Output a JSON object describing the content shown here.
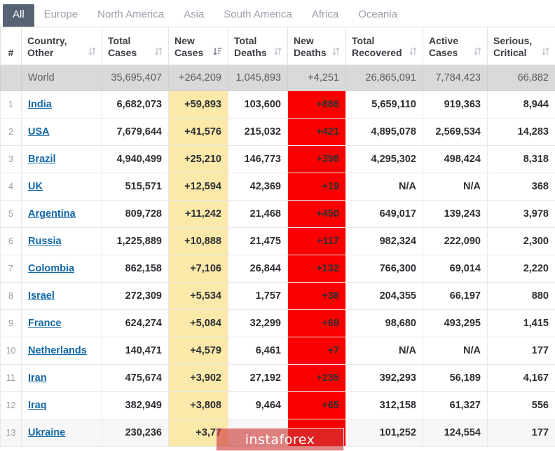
{
  "tabs": [
    {
      "label": "All",
      "active": true
    },
    {
      "label": "Europe",
      "active": false
    },
    {
      "label": "North America",
      "active": false
    },
    {
      "label": "Asia",
      "active": false
    },
    {
      "label": "South America",
      "active": false
    },
    {
      "label": "Africa",
      "active": false
    },
    {
      "label": "Oceania",
      "active": false
    }
  ],
  "columns": [
    {
      "key": "index",
      "label": "#",
      "sort_icon": ""
    },
    {
      "key": "country",
      "label": "Country,\nOther",
      "line1": "Country,",
      "line2": "Other",
      "sort_icon": "sort-both-icon"
    },
    {
      "key": "total_cases",
      "line1": "Total",
      "line2": "Cases",
      "sort_icon": "sort-both-icon"
    },
    {
      "key": "new_cases",
      "line1": "New",
      "line2": "Cases",
      "sort_icon": "sort-amount-desc-icon"
    },
    {
      "key": "total_deaths",
      "line1": "Total",
      "line2": "Deaths",
      "sort_icon": "sort-both-icon"
    },
    {
      "key": "new_deaths",
      "line1": "New",
      "line2": "Deaths",
      "sort_icon": "sort-both-icon"
    },
    {
      "key": "total_recovered",
      "line1": "Total",
      "line2": "Recovered",
      "sort_icon": "sort-both-icon"
    },
    {
      "key": "active_cases",
      "line1": "Active",
      "line2": "Cases",
      "sort_icon": "sort-both-icon"
    },
    {
      "key": "serious_critical",
      "line1": "Serious,",
      "line2": "Critical",
      "sort_icon": "sort-both-icon"
    }
  ],
  "world_row": {
    "index": "",
    "country": "World",
    "total_cases": "35,695,407",
    "new_cases": "+264,209",
    "total_deaths": "1,045,893",
    "new_deaths": "+4,251",
    "total_recovered": "26,865,091",
    "active_cases": "7,784,423",
    "serious_critical": "66,882"
  },
  "rows": [
    {
      "index": "1",
      "country": "India",
      "total_cases": "6,682,073",
      "new_cases": "+59,893",
      "total_deaths": "103,600",
      "new_deaths": "+886",
      "total_recovered": "5,659,110",
      "active_cases": "919,363",
      "serious_critical": "8,944"
    },
    {
      "index": "2",
      "country": "USA",
      "total_cases": "7,679,644",
      "new_cases": "+41,576",
      "total_deaths": "215,032",
      "new_deaths": "+421",
      "total_recovered": "4,895,078",
      "active_cases": "2,569,534",
      "serious_critical": "14,283"
    },
    {
      "index": "3",
      "country": "Brazil",
      "total_cases": "4,940,499",
      "new_cases": "+25,210",
      "total_deaths": "146,773",
      "new_deaths": "+398",
      "total_recovered": "4,295,302",
      "active_cases": "498,424",
      "serious_critical": "8,318"
    },
    {
      "index": "4",
      "country": "UK",
      "total_cases": "515,571",
      "new_cases": "+12,594",
      "total_deaths": "42,369",
      "new_deaths": "+19",
      "total_recovered": "N/A",
      "active_cases": "N/A",
      "serious_critical": "368"
    },
    {
      "index": "5",
      "country": "Argentina",
      "total_cases": "809,728",
      "new_cases": "+11,242",
      "total_deaths": "21,468",
      "new_deaths": "+450",
      "total_recovered": "649,017",
      "active_cases": "139,243",
      "serious_critical": "3,978"
    },
    {
      "index": "6",
      "country": "Russia",
      "total_cases": "1,225,889",
      "new_cases": "+10,888",
      "total_deaths": "21,475",
      "new_deaths": "+117",
      "total_recovered": "982,324",
      "active_cases": "222,090",
      "serious_critical": "2,300"
    },
    {
      "index": "7",
      "country": "Colombia",
      "total_cases": "862,158",
      "new_cases": "+7,106",
      "total_deaths": "26,844",
      "new_deaths": "+132",
      "total_recovered": "766,300",
      "active_cases": "69,014",
      "serious_critical": "2,220"
    },
    {
      "index": "8",
      "country": "Israel",
      "total_cases": "272,309",
      "new_cases": "+5,534",
      "total_deaths": "1,757",
      "new_deaths": "+38",
      "total_recovered": "204,355",
      "active_cases": "66,197",
      "serious_critical": "880"
    },
    {
      "index": "9",
      "country": "France",
      "total_cases": "624,274",
      "new_cases": "+5,084",
      "total_deaths": "32,299",
      "new_deaths": "+69",
      "total_recovered": "98,680",
      "active_cases": "493,295",
      "serious_critical": "1,415"
    },
    {
      "index": "10",
      "country": "Netherlands",
      "total_cases": "140,471",
      "new_cases": "+4,579",
      "total_deaths": "6,461",
      "new_deaths": "+7",
      "total_recovered": "N/A",
      "active_cases": "N/A",
      "serious_critical": "177"
    },
    {
      "index": "11",
      "country": "Iran",
      "total_cases": "475,674",
      "new_cases": "+3,902",
      "total_deaths": "27,192",
      "new_deaths": "+235",
      "total_recovered": "392,293",
      "active_cases": "56,189",
      "serious_critical": "4,167"
    },
    {
      "index": "12",
      "country": "Iraq",
      "total_cases": "382,949",
      "new_cases": "+3,808",
      "total_deaths": "9,464",
      "new_deaths": "+65",
      "total_recovered": "312,158",
      "active_cases": "61,327",
      "serious_critical": "556"
    },
    {
      "index": "13",
      "country": "Ukraine",
      "total_cases": "230,236",
      "new_cases": "+3,77",
      "total_deaths": "",
      "new_deaths": "",
      "total_recovered": "101,252",
      "active_cases": "124,554",
      "serious_critical": "177"
    }
  ],
  "watermark": {
    "text": "instaforex"
  },
  "colors": {
    "active_tab_bg": "#566373",
    "tab_text": "#9aa0ac",
    "new_cases_bg": "#fae9a8",
    "new_deaths_bg": "#fb0000",
    "world_row_bg": "#d9d9d9",
    "link": "#1268a8",
    "watermark_bg": "#cd3737"
  }
}
